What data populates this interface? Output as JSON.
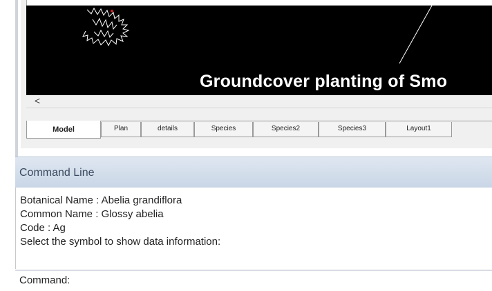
{
  "drawing": {
    "annotation_text": "Groundcover planting of Smo"
  },
  "scrollbar": {
    "left_arrow": "<"
  },
  "tabs": [
    {
      "label": "Model",
      "active": true
    },
    {
      "label": "Plan",
      "active": false
    },
    {
      "label": "details",
      "active": false
    },
    {
      "label": "Species",
      "active": false
    },
    {
      "label": "Species2",
      "active": false
    },
    {
      "label": "Species3",
      "active": false
    },
    {
      "label": "Layout1",
      "active": false
    }
  ],
  "command_line": {
    "title": "Command Line",
    "history": [
      "Botanical Name : Abelia grandiflora",
      "Common Name : Glossy abelia",
      "Code : Ag",
      "Select the symbol to show data information:"
    ],
    "prompt": "Command:",
    "input_value": ""
  },
  "colors": {
    "canvas_bg": "#000000",
    "annotation_text": "#ffffff",
    "command_header_bg": "#d3deec",
    "accent_red": "#cc2222"
  }
}
